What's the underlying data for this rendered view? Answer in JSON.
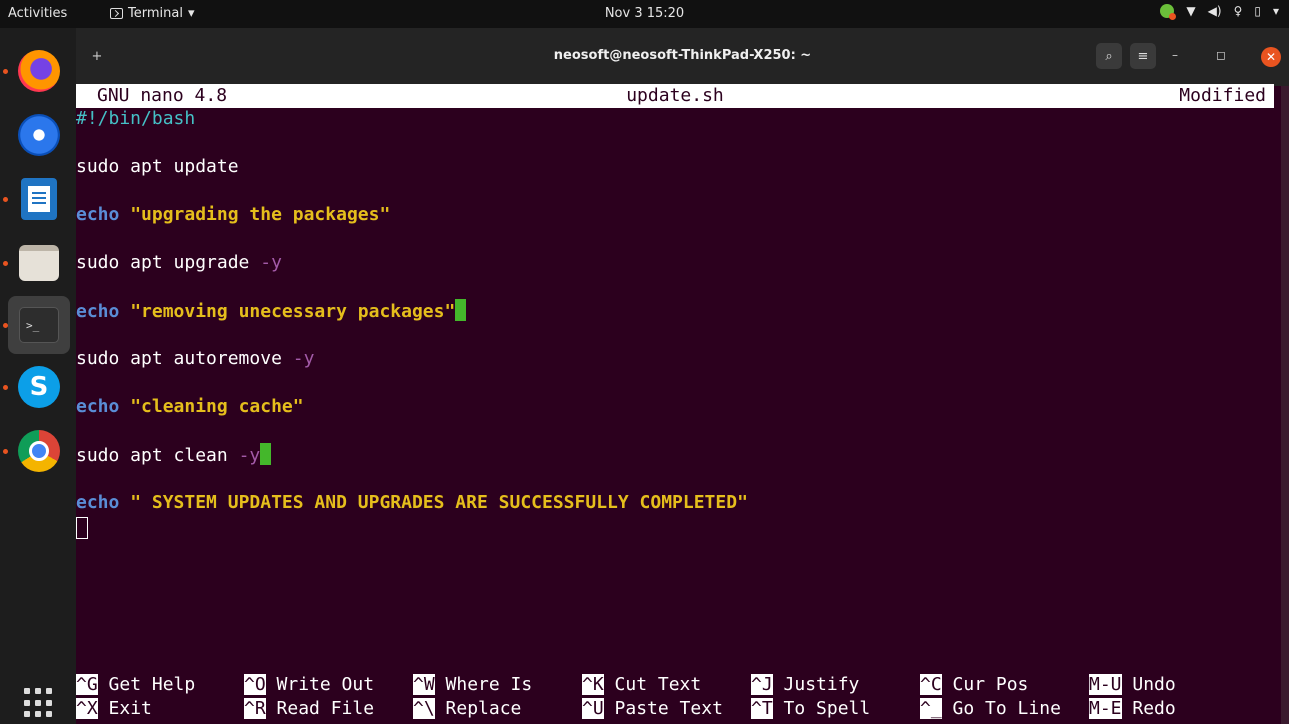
{
  "topbar": {
    "activities": "Activities",
    "app_menu": "Terminal",
    "clock": "Nov 3  15:20"
  },
  "dock": {
    "items": [
      "firefox-icon",
      "thunderbird-icon",
      "libreoffice-writer-icon",
      "files-icon",
      "terminal-icon",
      "skype-icon",
      "chrome-icon"
    ],
    "show_apps": "show-applications-icon"
  },
  "window": {
    "title": "neosoft@neosoft-ThinkPad-X250: ~",
    "new_tab_glyph": "+",
    "search_glyph": "⌕",
    "menu_glyph": "≡",
    "minimize_glyph": "–",
    "maximize_glyph": "◻",
    "close_glyph": "✕"
  },
  "nano": {
    "version": "GNU nano 4.8",
    "filename": "update.sh",
    "status": "Modified",
    "lines": {
      "shebang": "#!/bin/bash",
      "l3_cmd": "sudo apt update",
      "l5_kw": "echo",
      "l5_str": "\"upgrading the packages\"",
      "l7_cmd": "sudo apt upgrade ",
      "l7_opt": "-y",
      "l9_kw": "echo",
      "l9_str": "\"removing unecessary packages\"",
      "l11_cmd": "sudo apt autoremove ",
      "l11_opt": "-y",
      "l13_kw": "echo",
      "l13_str": "\"cleaning cache\"",
      "l15_cmd": "sudo apt clean ",
      "l15_opt": "-y",
      "l17_kw": "echo",
      "l17_str": "\" SYSTEM UPDATES AND UPGRADES ARE SUCCESSFULLY COMPLETED\""
    },
    "shortcuts": [
      {
        "key": "^G",
        "label": "Get Help"
      },
      {
        "key": "^O",
        "label": "Write Out"
      },
      {
        "key": "^W",
        "label": "Where Is"
      },
      {
        "key": "^K",
        "label": "Cut Text"
      },
      {
        "key": "^J",
        "label": "Justify"
      },
      {
        "key": "^C",
        "label": "Cur Pos"
      },
      {
        "key": "M-U",
        "label": "Undo"
      },
      {
        "key": "^X",
        "label": "Exit"
      },
      {
        "key": "^R",
        "label": "Read File"
      },
      {
        "key": "^\\",
        "label": "Replace"
      },
      {
        "key": "^U",
        "label": "Paste Text"
      },
      {
        "key": "^T",
        "label": "To Spell"
      },
      {
        "key": "^_",
        "label": "Go To Line"
      },
      {
        "key": "M-E",
        "label": "Redo"
      }
    ]
  }
}
